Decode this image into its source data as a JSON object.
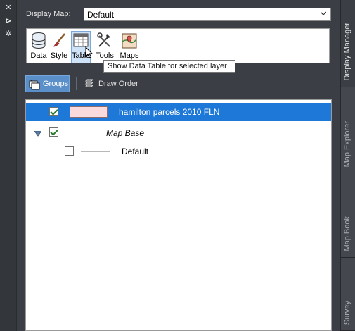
{
  "left_strip": {
    "buttons": [
      {
        "icon": "close-icon",
        "glyph": "✕"
      },
      {
        "icon": "pin-icon",
        "glyph": "⊳"
      },
      {
        "icon": "settings-icon",
        "glyph": "✲"
      }
    ]
  },
  "display_map": {
    "label": "Display Map:",
    "value": "Default"
  },
  "tools": [
    {
      "label": "Data",
      "icon": "database-icon"
    },
    {
      "label": "Style",
      "icon": "brush-icon"
    },
    {
      "label": "Table",
      "icon": "table-icon"
    },
    {
      "label": "Tools",
      "icon": "tools-icon"
    },
    {
      "label": "Maps",
      "icon": "map-icon"
    }
  ],
  "tooltip": "Show Data Table for selected layer",
  "view_buttons": {
    "groups": "Groups",
    "draw_order": "Draw Order"
  },
  "tree": {
    "layers": [
      {
        "label": "hamilton parcels 2010 FLN",
        "checked": true,
        "selected": true
      },
      {
        "label": "Map Base",
        "checked": true,
        "italic": true,
        "expanded": true
      },
      {
        "label": "Default",
        "checked": false
      }
    ]
  },
  "right_tabs": [
    {
      "label": "Display Manager",
      "active": true
    },
    {
      "label": "Map Explorer",
      "active": false
    },
    {
      "label": "Map Book",
      "active": false
    },
    {
      "label": "Survey",
      "active": false
    }
  ],
  "colors": {
    "selection": "#1e78d7",
    "groups_active": "#5b8fc9",
    "swatch_fill": "#fadadd"
  }
}
